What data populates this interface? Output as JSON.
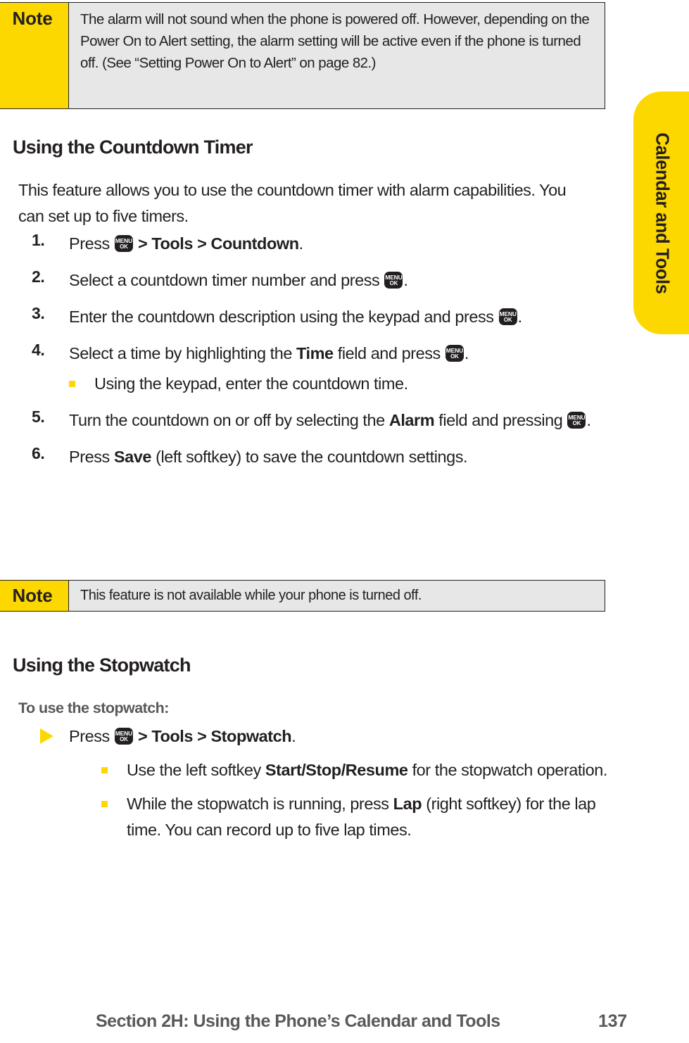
{
  "sidebar_tab": {
    "label": "Calendar and Tools",
    "color": "#fdd800"
  },
  "notes": [
    {
      "label": "Note",
      "text": "The alarm will not sound when the phone is powered off. However, depending on the Power On to Alert setting, the alarm setting will be active even if the phone is turned off. (See “Setting Power On to Alert” on page 82.)"
    },
    {
      "label": "Note",
      "text": "This feature is not available while your phone is turned off."
    }
  ],
  "countdown_section": {
    "heading": "Using the Countdown Timer",
    "intro": "This feature allows you to use the countdown timer with alarm capabilities. You can set up to five timers.",
    "steps": [
      {
        "num": "1.",
        "parts": [
          {
            "type": "text",
            "value": "Press "
          },
          {
            "type": "key",
            "value": "menu-ok-key"
          },
          {
            "type": "bold",
            "value": " > Tools > Countdown"
          },
          {
            "type": "text",
            "value": "."
          }
        ]
      },
      {
        "num": "2.",
        "parts": [
          {
            "type": "text",
            "value": "Select a countdown timer number and press "
          },
          {
            "type": "key",
            "value": "menu-ok-key"
          },
          {
            "type": "text",
            "value": "."
          }
        ]
      },
      {
        "num": "3.",
        "parts": [
          {
            "type": "text",
            "value": "Enter the countdown description using the keypad and press "
          },
          {
            "type": "key",
            "value": "menu-ok-key"
          },
          {
            "type": "text",
            "value": "."
          }
        ]
      },
      {
        "num": "4.",
        "parts": [
          {
            "type": "text",
            "value": "Select a time by highlighting the "
          },
          {
            "type": "bold",
            "value": "Time"
          },
          {
            "type": "text",
            "value": " field and press "
          },
          {
            "type": "key",
            "value": "menu-ok-key"
          },
          {
            "type": "text",
            "value": "."
          }
        ],
        "sub_bullets": [
          {
            "parts": [
              {
                "type": "text",
                "value": "Using the keypad, enter the countdown time."
              }
            ]
          }
        ]
      },
      {
        "num": "5.",
        "parts": [
          {
            "type": "text",
            "value": "Turn the countdown on or off by selecting the "
          },
          {
            "type": "bold",
            "value": "Alarm"
          },
          {
            "type": "text",
            "value": " field and pressing "
          },
          {
            "type": "key",
            "value": "menu-ok-key"
          },
          {
            "type": "text",
            "value": "."
          }
        ]
      },
      {
        "num": "6.",
        "parts": [
          {
            "type": "text",
            "value": "Press "
          },
          {
            "type": "bold",
            "value": "Save"
          },
          {
            "type": "text",
            "value": " (left softkey) to save the countdown settings."
          }
        ]
      }
    ]
  },
  "stopwatch_section": {
    "heading": "Using the Stopwatch",
    "sub_heading": "To use the stopwatch:",
    "arrow_item": {
      "parts": [
        {
          "type": "text",
          "value": "Press "
        },
        {
          "type": "key",
          "value": "menu-ok-key"
        },
        {
          "type": "bold",
          "value": " > Tools > Stopwatch"
        },
        {
          "type": "text",
          "value": "."
        }
      ],
      "sub_bullets": [
        {
          "parts": [
            {
              "type": "text",
              "value": "Use the left softkey "
            },
            {
              "type": "bold",
              "value": "Start/Stop/Resume"
            },
            {
              "type": "text",
              "value": " for the stopwatch operation."
            }
          ]
        },
        {
          "parts": [
            {
              "type": "text",
              "value": "While the stopwatch is running, press "
            },
            {
              "type": "bold",
              "value": "Lap"
            },
            {
              "type": "text",
              "value": " (right softkey) for the lap time. You can record up to five lap times."
            }
          ]
        }
      ]
    }
  },
  "key_glyph": {
    "top_label": "MENU",
    "bottom_label": "OK"
  },
  "footer": {
    "title": "Section 2H: Using the Phone’s Calendar and Tools",
    "page_number": "137"
  }
}
